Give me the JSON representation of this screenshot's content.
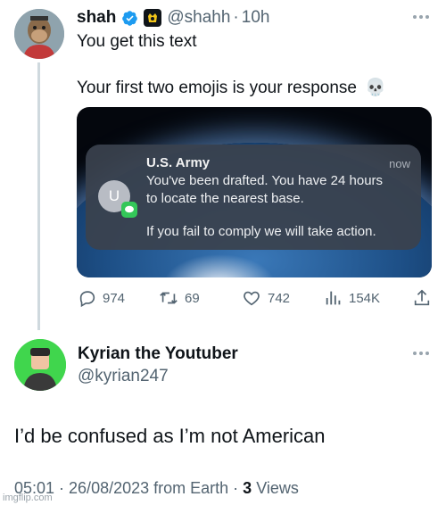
{
  "tweet": {
    "author_name": "shah",
    "handle": "@shahh",
    "separator": "·",
    "time": "10h",
    "text_line1": "You get this text",
    "text_line2": "Your first two emojis is your response",
    "emoji": "💀"
  },
  "media": {
    "sender": "U.S. Army",
    "avatar_initial": "U",
    "time": "now",
    "line1": "You've been drafted. You have 24 hours",
    "line2": "to locate the nearest base.",
    "line3": "If you fail to comply we will take action."
  },
  "actions": {
    "replies": "974",
    "retweets": "69",
    "likes": "742",
    "views": "154K"
  },
  "reply": {
    "author_name": "Kyrian the Youtuber",
    "handle": "@kyrian247",
    "text": "I’d be confused as I’m not American",
    "timestamp": "05:01 · 26/08/2023 from Earth ·",
    "views_count": "3",
    "views_label": "Views"
  },
  "watermark": "imgflip.com",
  "colors": {
    "verified": "#1d9bf0",
    "text_primary": "#0f1419",
    "text_secondary": "#536471",
    "thread_line": "#cfd9de",
    "reply_avatar_bg": "#40d64d"
  }
}
